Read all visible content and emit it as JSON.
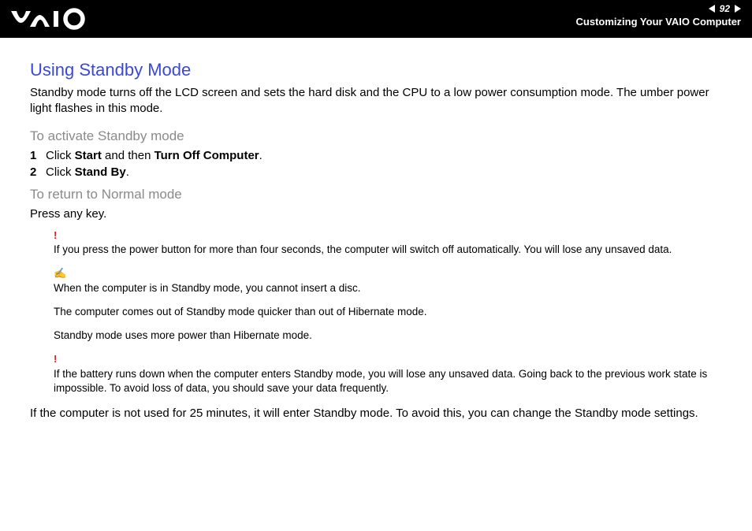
{
  "header": {
    "page_number": "92",
    "breadcrumb": "Customizing Your VAIO Computer"
  },
  "body": {
    "title": "Using Standby Mode",
    "intro": "Standby mode turns off the LCD screen and sets the hard disk and the CPU to a low power consumption mode. The umber power light flashes in this mode.",
    "activate_heading": "To activate Standby mode",
    "steps": {
      "s1": {
        "num": "1",
        "pre": "Click ",
        "b1": "Start",
        "mid": " and then ",
        "b2": "Turn Off Computer",
        "post": "."
      },
      "s2": {
        "num": "2",
        "pre": "Click ",
        "b1": "Stand By",
        "post": "."
      }
    },
    "return_heading": "To return to Normal mode",
    "return_text": "Press any key.",
    "warn1_mark": "!",
    "warn1": "If you press the power button for more than four seconds, the computer will switch off automatically. You will lose any unsaved data.",
    "tip_mark": "✍",
    "tip1": "When the computer is in Standby mode, you cannot insert a disc.",
    "tip2": "The computer comes out of Standby mode quicker than out of Hibernate mode.",
    "tip3": "Standby mode uses more power than Hibernate mode.",
    "warn2_mark": "!",
    "warn2": "If the battery runs down when the computer enters Standby mode, you will lose any unsaved data. Going back to the previous work state is impossible. To avoid loss of data, you should save your data frequently.",
    "closing": "If the computer is not used for 25 minutes, it will enter Standby mode. To avoid this, you can change the Standby mode settings."
  }
}
